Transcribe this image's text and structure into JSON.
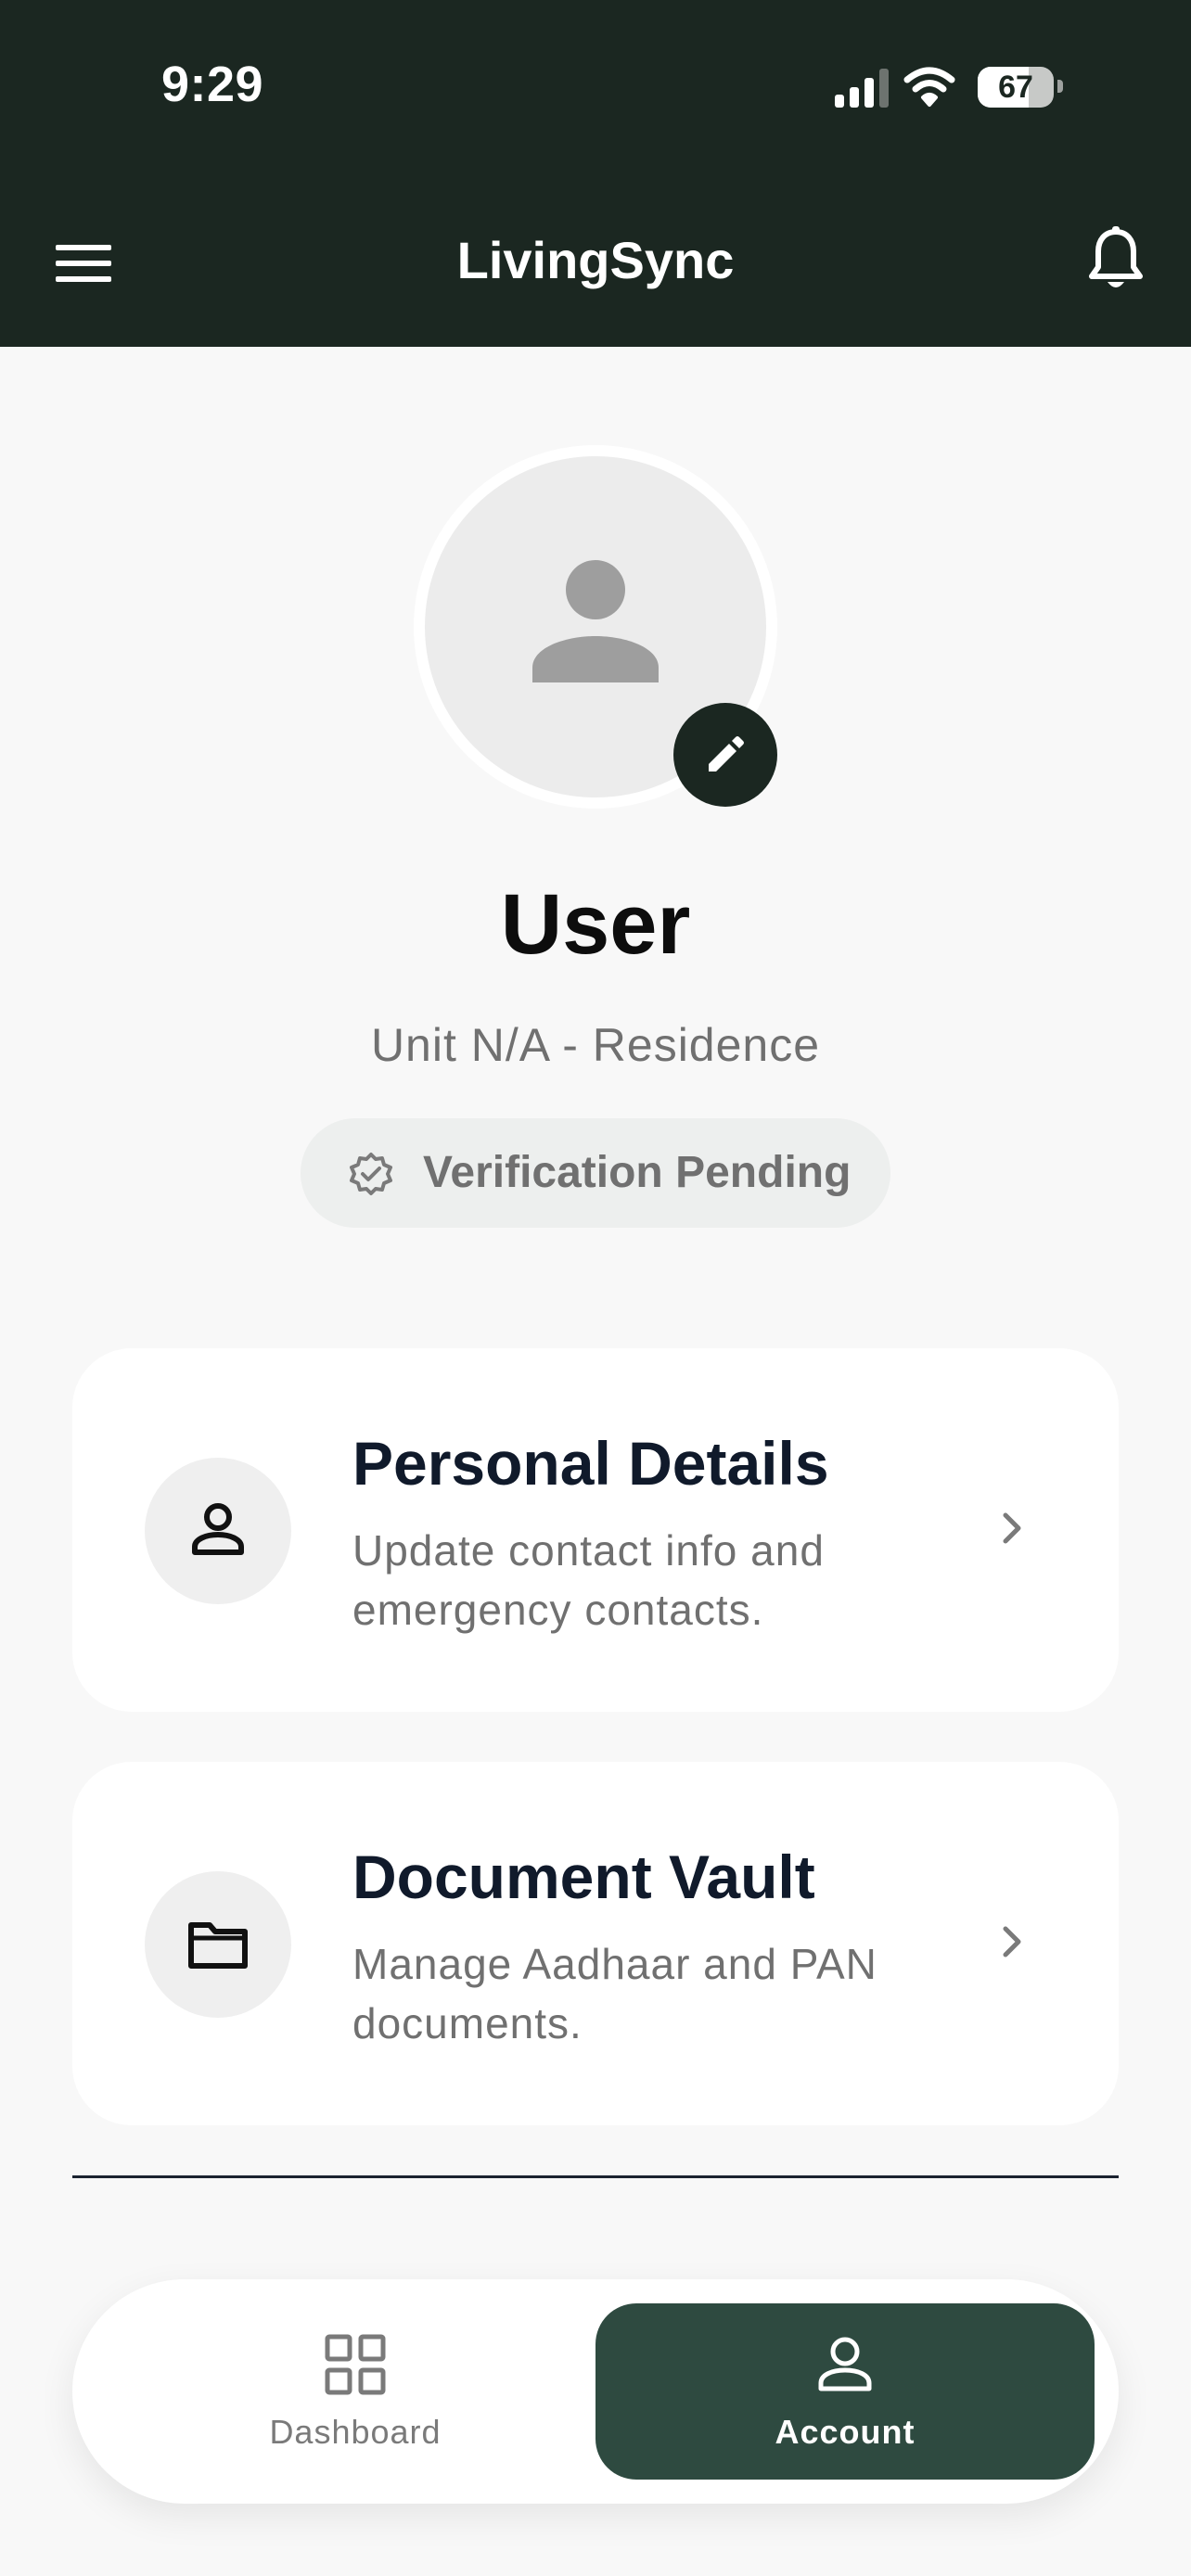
{
  "status_bar": {
    "time": "9:29",
    "battery_level": "67",
    "battery_fraction": 0.67,
    "icons": [
      "signal-icon",
      "wifi-icon",
      "battery-icon"
    ]
  },
  "header": {
    "title": "LivingSync",
    "icons": [
      "menu-icon",
      "bell-icon"
    ]
  },
  "profile": {
    "name": "User",
    "unit": "Unit N/A - Residence",
    "verification_status": "Verification Pending",
    "icons": [
      "avatar-placeholder-icon",
      "pencil-icon",
      "verified-badge-icon"
    ]
  },
  "cards": [
    {
      "title": "Personal Details",
      "description": "Update contact info and emergency contacts.",
      "icon": "person-icon"
    },
    {
      "title": "Document Vault",
      "description": "Manage Aadhaar and PAN documents.",
      "icon": "folder-icon"
    }
  ],
  "bottom_nav": {
    "tabs": [
      {
        "label": "Dashboard",
        "icon": "grid-icon",
        "active": false
      },
      {
        "label": "Account",
        "icon": "person-icon",
        "active": true
      }
    ]
  },
  "colors": {
    "header_bg": "#1b2721",
    "page_bg": "#f8f8f8",
    "active_tab_bg": "#2e4a40",
    "card_title": "#101a2b",
    "muted_text": "#707070"
  }
}
